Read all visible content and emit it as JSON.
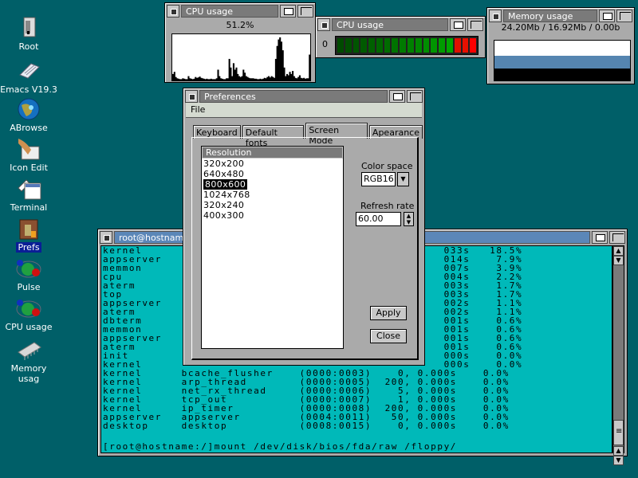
{
  "desktop": {
    "icons": [
      {
        "label": "Root",
        "icon": "computer-tower-icon",
        "selected": false
      },
      {
        "label": "Emacs V19.3",
        "icon": "scroll-icon",
        "selected": false
      },
      {
        "label": "ABrowse",
        "icon": "globe-icon",
        "selected": false
      },
      {
        "label": "Icon Edit",
        "icon": "paint-icon",
        "selected": false
      },
      {
        "label": "Terminal",
        "icon": "terminal-window-icon",
        "selected": false
      },
      {
        "label": "Prefs",
        "icon": "prefs-book-icon",
        "selected": true
      },
      {
        "label": "Pulse",
        "icon": "pulse-atoms-icon",
        "selected": false
      },
      {
        "label": "CPU usage",
        "icon": "cpu-atoms-icon",
        "selected": false
      },
      {
        "label": "Memory usag",
        "icon": "memory-chip-icon",
        "selected": false
      }
    ]
  },
  "cpu_graph_window": {
    "title": "CPU usage",
    "percent": "51.2%",
    "history": [
      0.15,
      0.2,
      0.08,
      0.05,
      0.04,
      0.03,
      0.03,
      0.05,
      0.04,
      0.03,
      0.03,
      0.1,
      0.05,
      0.04,
      0.03,
      0.04,
      0.08,
      0.06,
      0.07,
      0.09,
      0.06,
      0.05,
      0.04,
      0.03,
      0.04,
      0.03,
      0.03,
      0.04,
      0.03,
      0.03,
      0.03,
      0.05,
      0.25,
      0.1,
      0.05,
      0.04,
      0.03,
      0.03,
      0.05,
      0.05,
      0.5,
      0.3,
      0.1,
      0.4,
      0.25,
      0.3,
      0.15,
      0.1,
      0.08,
      0.1,
      0.25,
      0.18,
      0.1,
      0.08,
      0.06,
      0.05,
      0.05,
      0.05,
      0.04,
      0.04,
      0.03,
      0.03,
      0.04,
      0.03,
      0.04,
      0.06,
      0.05,
      0.08,
      0.1,
      0.07,
      0.1,
      0.08,
      0.06,
      0.5,
      0.8,
      0.95,
      1.0,
      0.9,
      0.7,
      0.3,
      0.1,
      0.15,
      0.12,
      0.2,
      0.15,
      0.22,
      0.1,
      0.06,
      0.05,
      0.08,
      0.12,
      0.06,
      0.05,
      0.06,
      0.04,
      0.05,
      0.05,
      0.6
    ]
  },
  "cpu_meter_window": {
    "title": "CPU usage",
    "label": "0",
    "segments": 18,
    "level": 1.0,
    "colors": [
      "#004a00",
      "#004f00",
      "#005500",
      "#005a00",
      "#006000",
      "#006600",
      "#006c00",
      "#007300",
      "#007a00",
      "#008000",
      "#008700",
      "#008e00",
      "#009500",
      "#009c00",
      "#00a600",
      "#e01000",
      "#e81000",
      "#ff0000"
    ]
  },
  "memory_window": {
    "title": "Memory usage",
    "summary": "24.20Mb / 16.92Mb / 0.00b",
    "used_fraction": 0.3,
    "cache_fraction": 0.33,
    "cache_color": "#5585b0"
  },
  "terminal_window": {
    "title": "root@hostname:/",
    "rows": [
      "kernel                                              033s   18.5%",
      "appserver                                           014s    7.9%",
      "memmon                                              007s    3.9%",
      "cpu                                                 004s    2.2%",
      "aterm                                               003s    1.7%",
      "top                                                 003s    1.7%",
      "appserver                                           002s    1.1%",
      "aterm                                               002s    1.1%",
      "dbterm                                              001s    0.6%",
      "memmon                                              001s    0.6%",
      "appserver                                           001s    0.6%",
      "aterm                                               001s    0.6%",
      "init                                                000s    0.0%",
      "kernel                                              000s    0.0%",
      "kernel      bcache_flusher    (0000:0003)    0, 0.000s    0.0%",
      "kernel      arp_thread        (0000:0005)  200, 0.000s    0.0%",
      "kernel      net_rx_thread     (0000:0006)    5, 0.000s    0.0%",
      "kernel      tcp_out           (0000:0007)    1, 0.000s    0.0%",
      "kernel      ip_timer          (0000:0008)  200, 0.000s    0.0%",
      "appserver   appserver         (0004:0011)   50, 0.000s    0.0%",
      "desktop     desktop           (0008:0015)    0, 0.000s    0.0%"
    ],
    "command_line": "[root@hostname:/]mount /dev/disk/bios/fda/raw /floppy/"
  },
  "preferences_window": {
    "title": "Preferences",
    "menu": [
      "File"
    ],
    "tabs": [
      {
        "label": "Keyboard",
        "active": false
      },
      {
        "label": "Default fonts",
        "active": false
      },
      {
        "label": "Screen Mode",
        "active": true
      },
      {
        "label": "Apearance",
        "active": false
      }
    ],
    "resolution_header": "Resolution",
    "resolutions": [
      "320x200",
      "640x480",
      "800x600",
      "1024x768",
      "320x240",
      "400x300"
    ],
    "selected_resolution": "800x600",
    "color_space_label": "Color space",
    "color_space_value": "RGB16",
    "refresh_rate_label": "Refresh rate",
    "refresh_rate_value": "60.00",
    "apply_label": "Apply",
    "close_label": "Close"
  }
}
